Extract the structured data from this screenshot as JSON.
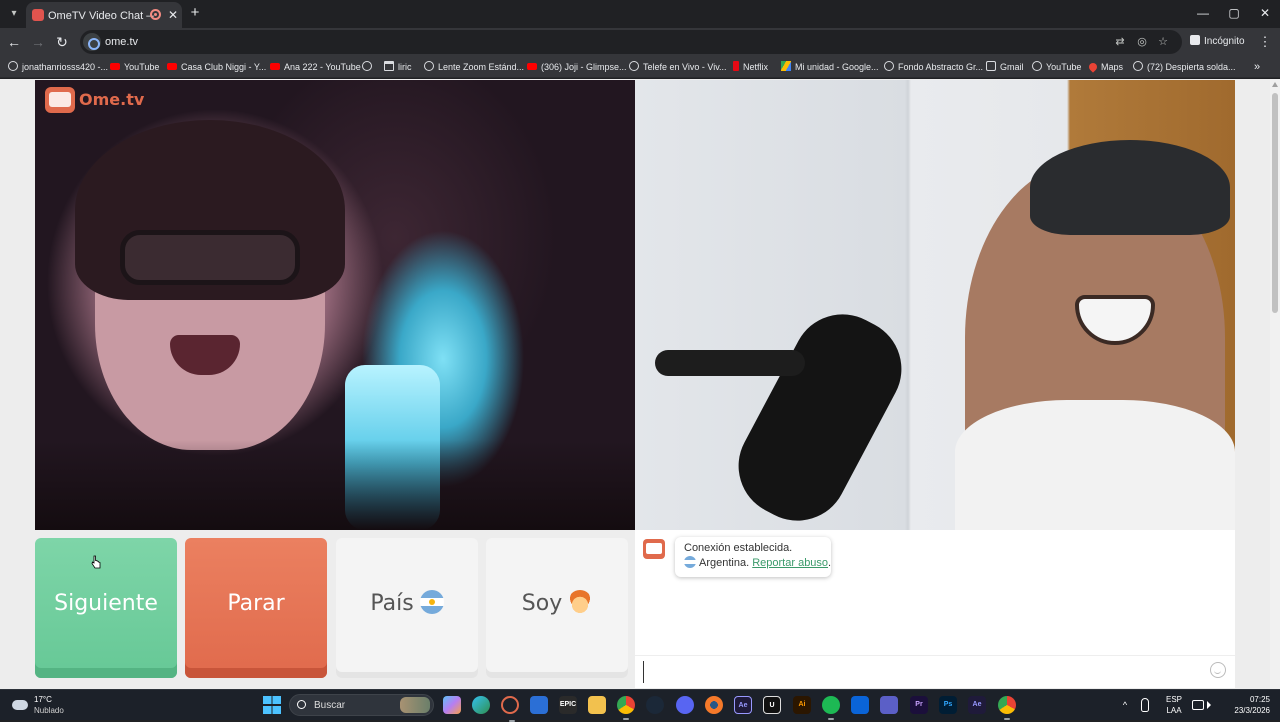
{
  "browser": {
    "tab": {
      "title": "OmeTV Video Chat — Ome"
    },
    "new_tab_label": "+",
    "window_controls": {
      "minimize": "—",
      "maximize": "▢",
      "close": "✕"
    },
    "url": "ome.tv",
    "incognito_label": "Incógnito",
    "bookmarks": [
      {
        "label": "jonathanriosss420 -...",
        "icon": "globe-icon"
      },
      {
        "label": "YouTube",
        "icon": "youtube-icon"
      },
      {
        "label": "Casa Club Niggi - Y...",
        "icon": "youtube-icon"
      },
      {
        "label": "Ana 222 - YouTube",
        "icon": "youtube-icon"
      },
      {
        "label": "",
        "icon": "globe-icon"
      },
      {
        "label": "liric",
        "icon": "folder-icon"
      },
      {
        "label": "Lente Zoom Estánd...",
        "icon": "globe-icon"
      },
      {
        "label": "(306) Joji - Glimpse...",
        "icon": "youtube-icon"
      },
      {
        "label": "Telefe en Vivo - Viv...",
        "icon": "globe-icon"
      },
      {
        "label": "Netflix",
        "icon": "netflix-icon"
      },
      {
        "label": "Mi unidad - Google...",
        "icon": "drive-icon"
      },
      {
        "label": "Fondo Abstracto Gr...",
        "icon": "globe-icon"
      },
      {
        "label": "Gmail",
        "icon": "globe-icon"
      },
      {
        "label": "YouTube",
        "icon": "globe-icon"
      },
      {
        "label": "Maps",
        "icon": "maps-icon"
      },
      {
        "label": "(72) Despierta solda...",
        "icon": "globe-icon"
      }
    ],
    "bookmarks_overflow": "»"
  },
  "page": {
    "logo_text": "Ome.tv",
    "buttons": {
      "next": "Siguiente",
      "stop": "Parar",
      "country": "País",
      "gender": "Soy"
    },
    "chat": {
      "connected": "Conexión establecida.",
      "country": "Argentina.",
      "report": "Reportar abuso",
      "period": ".",
      "input_value": ""
    }
  },
  "taskbar": {
    "weather": {
      "temp": "17°C",
      "desc": "Nublado"
    },
    "search_placeholder": "Buscar",
    "apps": [
      "copilot-icon",
      "edge-icon",
      "app-icon",
      "store-icon",
      "epic-games-icon",
      "file-explorer-icon",
      "chrome-icon",
      "steam-icon",
      "discord-icon",
      "blender-icon",
      "after-effects-icon",
      "unreal-icon",
      "illustrator-icon",
      "spotify-icon",
      "outlook-icon",
      "teams-icon",
      "premiere-icon",
      "photoshop-icon",
      "after-effects-2-icon",
      "chrome-2-icon"
    ],
    "lang": {
      "line1": "ESP",
      "line2": "LAA"
    },
    "clock": {
      "time": "07:25",
      "date": "23/3/2026"
    }
  },
  "colors": {
    "next_button": "#66c896",
    "stop_button": "#e06a4c",
    "neutral_button": "#f4f4f4",
    "link": "#3a9a6a",
    "brand": "#e06a4c"
  }
}
